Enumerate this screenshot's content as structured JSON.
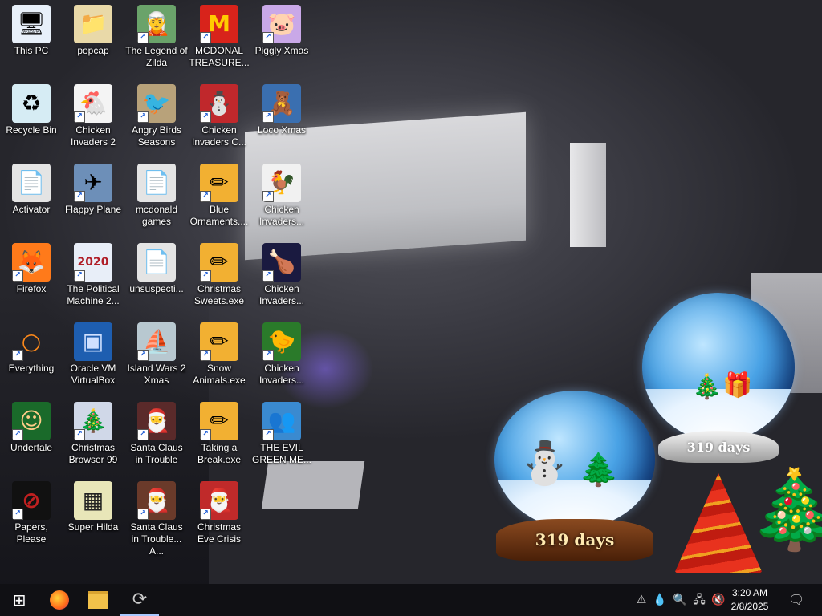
{
  "desktop": {
    "icons": [
      {
        "label": "This PC",
        "glyph": "🖥",
        "icon": "computer-icon",
        "bg": "#e8f0fa",
        "shortcut": false
      },
      {
        "label": "popcap",
        "glyph": "📁",
        "icon": "folder-icon",
        "bg": "#e9d9a8",
        "shortcut": false
      },
      {
        "label": "The Legend of Zilda",
        "glyph": "🧝",
        "icon": "game-character-icon",
        "bg": "#6aa36a",
        "shortcut": true
      },
      {
        "label": "MCDONAL TREASURE...",
        "glyph": "M",
        "icon": "mcdonalds-logo-icon",
        "bg": "#d8231b",
        "fg": "#ffcc00",
        "shortcut": true
      },
      {
        "label": "Piggly Xmas",
        "glyph": "🐷",
        "icon": "pig-icon",
        "bg": "#c9a8e8",
        "shortcut": true
      },
      {
        "label": "Recycle Bin",
        "glyph": "♻",
        "icon": "recycle-bin-icon",
        "bg": "#d6ecf4",
        "shortcut": false
      },
      {
        "label": "Chicken Invaders 2",
        "glyph": "🐔",
        "icon": "chicken-icon",
        "bg": "#f4f4f4",
        "shortcut": true
      },
      {
        "label": "Angry Birds Seasons",
        "glyph": "🐦",
        "icon": "angry-bird-icon",
        "bg": "#b8a27a",
        "shortcut": true
      },
      {
        "label": "Chicken Invaders C...",
        "glyph": "⛄",
        "icon": "snowman-icon",
        "bg": "#c0282c",
        "shortcut": true
      },
      {
        "label": "Loco Xmas",
        "glyph": "🧸",
        "icon": "teddy-bear-icon",
        "bg": "#3a6fb0",
        "shortcut": true
      },
      {
        "label": "Activator",
        "glyph": "📄",
        "icon": "folder-icon",
        "bg": "#e4e4e4",
        "shortcut": false
      },
      {
        "label": "Flappy Plane",
        "glyph": "✈",
        "icon": "plane-icon",
        "bg": "#6d8fb8",
        "shortcut": true
      },
      {
        "label": "mcdonald games",
        "glyph": "📄",
        "icon": "folder-icon",
        "bg": "#e4e4e4",
        "shortcut": false
      },
      {
        "label": "Blue Ornaments....",
        "glyph": "✏",
        "icon": "installer-icon",
        "bg": "#f2b032",
        "shortcut": true
      },
      {
        "label": "Chicken Invaders...",
        "glyph": "🐓",
        "icon": "chicken-santa-icon",
        "bg": "#f1f1f1",
        "shortcut": true
      },
      {
        "label": "Firefox",
        "glyph": "🦊",
        "icon": "firefox-icon",
        "bg": "#ff7a1a",
        "shortcut": true
      },
      {
        "label": "The Political Machine 2...",
        "glyph": "2020",
        "icon": "political-machine-icon",
        "bg": "#e8eef8",
        "fg": "#b01e28",
        "shortcut": true
      },
      {
        "label": "unsuspecti...",
        "glyph": "📄",
        "icon": "folder-icon",
        "bg": "#e4e4e4",
        "shortcut": false
      },
      {
        "label": "Christmas Sweets.exe",
        "glyph": "✏",
        "icon": "installer-icon",
        "bg": "#f2b032",
        "shortcut": true
      },
      {
        "label": "Chicken Invaders...",
        "glyph": "🍗",
        "icon": "chicken-invaders-icon",
        "bg": "#1a1a40",
        "shortcut": true
      },
      {
        "label": "Everything",
        "glyph": "○",
        "icon": "search-magnifier-icon",
        "bg": "transparent",
        "fg": "#ff8a1a",
        "shortcut": true
      },
      {
        "label": "Oracle VM VirtualBox",
        "glyph": "▣",
        "icon": "virtualbox-icon",
        "bg": "#1e5eb0",
        "fg": "#cfe0ff",
        "shortcut": false
      },
      {
        "label": "Island Wars 2 Xmas",
        "glyph": "⛵",
        "icon": "island-icon",
        "bg": "#b8c8d0",
        "shortcut": true
      },
      {
        "label": "Snow Animals.exe",
        "glyph": "✏",
        "icon": "installer-icon",
        "bg": "#f2b032",
        "shortcut": true
      },
      {
        "label": "Chicken Invaders...",
        "glyph": "🐤",
        "icon": "chicken-invaders-icon",
        "bg": "#2a7a2a",
        "shortcut": true
      },
      {
        "label": "Undertale",
        "glyph": "☺",
        "icon": "undertale-icon",
        "bg": "#1a6a2a",
        "fg": "#ffcc88",
        "shortcut": true
      },
      {
        "label": "Christmas Browser 99",
        "glyph": "🎄",
        "icon": "christmas-tree-icon",
        "bg": "#d0d8e8",
        "shortcut": true
      },
      {
        "label": "Santa Claus in Trouble",
        "glyph": "🎅",
        "icon": "santa-icon",
        "bg": "#5a2a2a",
        "shortcut": true
      },
      {
        "label": "Taking a Break.exe",
        "glyph": "✏",
        "icon": "installer-icon",
        "bg": "#f2b032",
        "shortcut": true
      },
      {
        "label": "THE EVIL GREEN ME...",
        "glyph": "👥",
        "icon": "messenger-icon",
        "bg": "#3a8ad0",
        "shortcut": true
      },
      {
        "label": "Papers, Please",
        "glyph": "⊘",
        "icon": "papers-please-icon",
        "bg": "#111",
        "fg": "#c02020",
        "shortcut": true
      },
      {
        "label": "Super Hilda",
        "glyph": "▦",
        "icon": "pixel-character-icon",
        "bg": "#e8e6b8",
        "fg": "#222",
        "shortcut": false
      },
      {
        "label": "Santa Claus in Trouble... A...",
        "glyph": "🎅",
        "icon": "santa-icon",
        "bg": "#6a3a2a",
        "shortcut": true
      },
      {
        "label": "Christmas Eve Crisis",
        "glyph": "🎅",
        "icon": "santa-icon",
        "bg": "#c02a2a",
        "shortcut": true
      }
    ]
  },
  "widgets": {
    "globe_left_days": "319 days",
    "globe_right_days": "319 days"
  },
  "taskbar": {
    "start_icon": "windows-logo-icon",
    "pinned": [
      "firefox-icon",
      "file-explorer-icon",
      "loading-icon"
    ],
    "clock": {
      "time": "3:20 AM",
      "date": "2/8/2025"
    },
    "tray": [
      "network-error-icon",
      "drop-icon",
      "search-magnifier-icon",
      "network-icon",
      "volume-muted-icon",
      "notification-icon"
    ]
  }
}
